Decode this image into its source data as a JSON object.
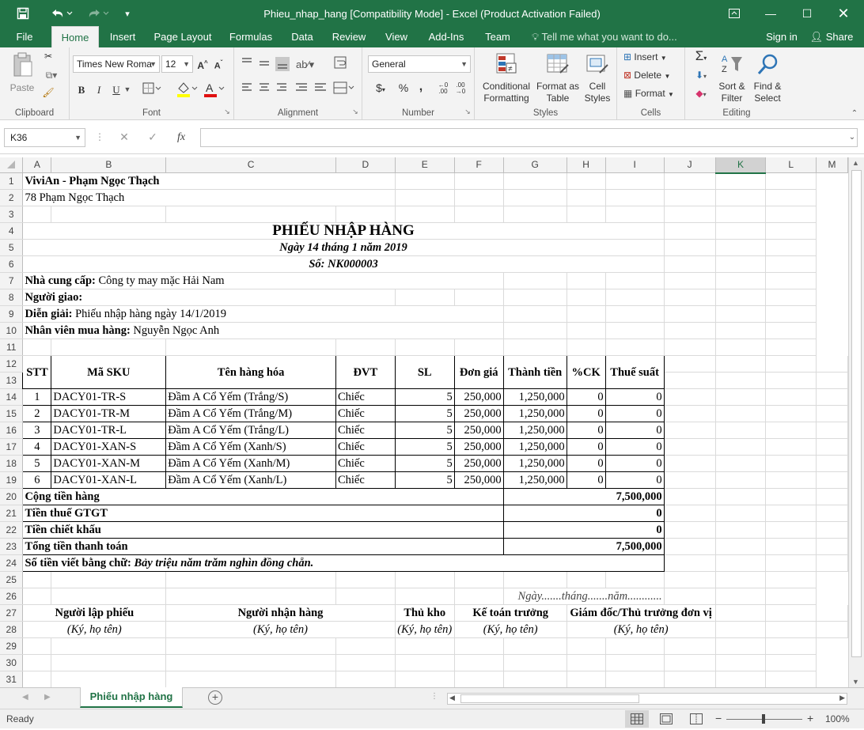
{
  "window": {
    "title": "Phieu_nhap_hang  [Compatibility Mode] - Excel (Product Activation Failed)"
  },
  "tabs": [
    "File",
    "Home",
    "Insert",
    "Page Layout",
    "Formulas",
    "Data",
    "Review",
    "View",
    "Add-Ins",
    "Team"
  ],
  "tell_me": "Tell me what you want to do...",
  "account": {
    "signin": "Sign in",
    "share": "Share"
  },
  "ribbon": {
    "clipboard": {
      "label": "Clipboard",
      "paste": "Paste"
    },
    "font": {
      "label": "Font",
      "name": "Times New Roma",
      "size": "12",
      "bold": "B",
      "italic": "I",
      "underline": "U"
    },
    "alignment": {
      "label": "Alignment"
    },
    "number": {
      "label": "Number",
      "format": "General",
      "currency": "$",
      "percent": "%",
      "comma": ","
    },
    "styles": {
      "label": "Styles",
      "conditional": "Conditional Formatting",
      "format_table": "Format as Table",
      "cell_styles": "Cell Styles"
    },
    "cells": {
      "label": "Cells",
      "insert": "Insert",
      "delete": "Delete",
      "format": "Format"
    },
    "editing": {
      "label": "Editing",
      "sort": "Sort & Filter",
      "find": "Find & Select"
    }
  },
  "formula_bar": {
    "name_box": "K36",
    "fx": "fx",
    "value": ""
  },
  "columns": [
    "A",
    "B",
    "C",
    "D",
    "E",
    "F",
    "G",
    "H",
    "I",
    "J",
    "K",
    "L",
    "M"
  ],
  "selected_column": "K",
  "sheet": {
    "company": "ViviAn - Phạm Ngọc Thạch",
    "address": "78 Phạm Ngọc Thạch",
    "title": "PHIẾU NHẬP HÀNG",
    "date": "Ngày 14 tháng 1 năm 2019",
    "number": "Số: NK000003",
    "supplier_label": "Nhà cung cấp:",
    "supplier": "Công ty may mặc Hải Nam",
    "deliverer_label": "Người giao:",
    "desc_label": "Diễn giải:",
    "desc": "Phiếu nhập hàng ngày 14/1/2019",
    "buyer_label": "Nhân viên mua hàng:",
    "buyer": "Nguyễn Ngọc Anh",
    "headers": [
      "STT",
      "Mã SKU",
      "Tên hàng hóa",
      "ĐVT",
      "SL",
      "Đơn giá",
      "Thành tiền",
      "%CK",
      "Thuế suất"
    ],
    "rows": [
      {
        "stt": "1",
        "sku": "DACY01-TR-S",
        "name": "Đầm A Cổ Yếm (Trắng/S)",
        "unit": "Chiếc",
        "qty": "5",
        "price": "250,000",
        "amount": "1,250,000",
        "ck": "0",
        "tax": "0"
      },
      {
        "stt": "2",
        "sku": "DACY01-TR-M",
        "name": "Đầm A Cổ Yếm (Trắng/M)",
        "unit": "Chiếc",
        "qty": "5",
        "price": "250,000",
        "amount": "1,250,000",
        "ck": "0",
        "tax": "0"
      },
      {
        "stt": "3",
        "sku": "DACY01-TR-L",
        "name": "Đầm A Cổ Yếm (Trắng/L)",
        "unit": "Chiếc",
        "qty": "5",
        "price": "250,000",
        "amount": "1,250,000",
        "ck": "0",
        "tax": "0"
      },
      {
        "stt": "4",
        "sku": "DACY01-XAN-S",
        "name": "Đầm A Cổ Yếm (Xanh/S)",
        "unit": "Chiếc",
        "qty": "5",
        "price": "250,000",
        "amount": "1,250,000",
        "ck": "0",
        "tax": "0"
      },
      {
        "stt": "5",
        "sku": "DACY01-XAN-M",
        "name": "Đầm A Cổ Yếm (Xanh/M)",
        "unit": "Chiếc",
        "qty": "5",
        "price": "250,000",
        "amount": "1,250,000",
        "ck": "0",
        "tax": "0"
      },
      {
        "stt": "6",
        "sku": "DACY01-XAN-L",
        "name": "Đầm A Cổ Yếm (Xanh/L)",
        "unit": "Chiếc",
        "qty": "5",
        "price": "250,000",
        "amount": "1,250,000",
        "ck": "0",
        "tax": "0"
      }
    ],
    "totals": [
      {
        "label": "Cộng tiền hàng",
        "value": "7,500,000"
      },
      {
        "label": "Tiền thuế GTGT",
        "value": "0"
      },
      {
        "label": "Tiền chiết khấu",
        "value": "0"
      },
      {
        "label": "Tổng tiền thanh toán",
        "value": "7,500,000"
      }
    ],
    "words_label": "Số tiền viết bằng chữ:",
    "words": "Bảy triệu năm trăm nghìn đồng chẵn.",
    "sign_date": "Ngày.......tháng.......năm............",
    "signers": [
      "Người lập phiếu",
      "Người nhận hàng",
      "Thủ kho",
      "Kế toán trưởng",
      "Giám đốc/Thủ trưởng đơn vị"
    ],
    "sign_note": "(Ký, họ tên)"
  },
  "sheet_tab": "Phiếu nhập hàng",
  "status": {
    "ready": "Ready",
    "zoom": "100%"
  },
  "colors": {
    "brand": "#217346"
  }
}
